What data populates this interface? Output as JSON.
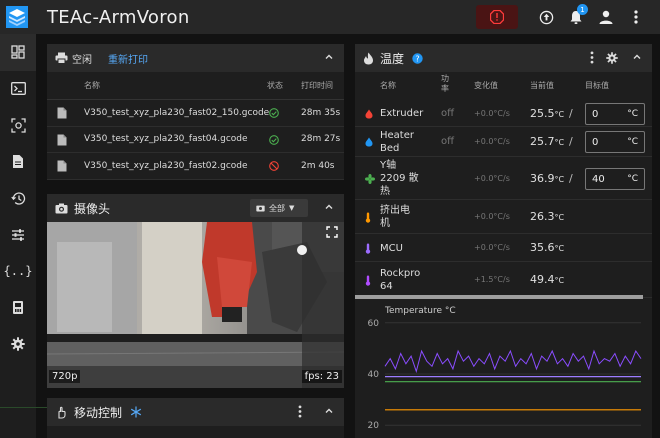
{
  "app": {
    "title": "TEAc-ArmVoron",
    "notification_count": "1"
  },
  "icons": {
    "logo": "stacked-layers-logo",
    "emergency": "emergency-stop-icon",
    "update": "arrow-up-circle-icon",
    "bell": "bell-icon",
    "user": "account-icon",
    "menu": "dots-vertical-icon"
  },
  "sidebar": {
    "items": [
      {
        "name": "dashboard"
      },
      {
        "name": "console"
      },
      {
        "name": "webcam"
      },
      {
        "name": "files"
      },
      {
        "name": "history"
      },
      {
        "name": "tune"
      },
      {
        "name": "macros"
      },
      {
        "name": "system"
      },
      {
        "name": "settings"
      }
    ]
  },
  "jobs": {
    "status_label": "空闲",
    "reprint_label": "重新打印",
    "headers": {
      "name": "名称",
      "status": "状态",
      "print_time": "打印时间"
    },
    "rows": [
      {
        "name": "V350_test_xyz_pla230_fast02_150.gcode",
        "status": "success",
        "time": "28m 35s"
      },
      {
        "name": "V350_test_xyz_pla230_fast04.gcode",
        "status": "success",
        "time": "28m 27s"
      },
      {
        "name": "V350_test_xyz_pla230_fast02.gcode",
        "status": "cancelled",
        "time": "2m 40s"
      }
    ]
  },
  "camera": {
    "title": "摄像头",
    "select_value": "全部",
    "resolution": "720p",
    "fps": "fps: 23"
  },
  "motion": {
    "title": "移动控制"
  },
  "temperature": {
    "title": "温度",
    "headers": {
      "name": "名称",
      "power": "功\n率",
      "rate": "变化值",
      "current": "当前值",
      "target": "目标值"
    },
    "rows": [
      {
        "name": "Extruder",
        "power": "off",
        "rate": "+0.0°C/s",
        "current": "25.5",
        "unit": "°C",
        "target": "0",
        "target_unit": "°C",
        "color": "#f44336"
      },
      {
        "name": "Heater\nBed",
        "power": "off",
        "rate": "+0.0°C/s",
        "current": "25.7",
        "unit": "°C",
        "target": "0",
        "target_unit": "°C",
        "color": "#2196f3"
      },
      {
        "name": "Y轴\n2209 散\n热",
        "power": "",
        "rate": "+0.0°C/s",
        "current": "36.9",
        "unit": "°C",
        "target": "40",
        "target_unit": "°C",
        "color": "#4caf50"
      },
      {
        "name": "挤出电\n机",
        "power": "",
        "rate": "+0.0°C/s",
        "current": "26.3",
        "unit": "°C",
        "color": "#ff9800"
      },
      {
        "name": "MCU",
        "power": "",
        "rate": "+0.0°C/s",
        "current": "35.6",
        "unit": "°C",
        "color": "#9c6cff"
      },
      {
        "name": "Rockpro\n64",
        "power": "",
        "rate": "+1.5°C/s",
        "current": "49.4",
        "unit": "°C",
        "color": "#b04cff"
      }
    ]
  },
  "chart_data": {
    "type": "line",
    "title": "Temperature °C",
    "yticks": [
      60,
      40,
      20
    ],
    "series": [
      {
        "values": [
          43,
          46,
          42,
          48,
          44,
          47,
          41,
          49,
          45,
          43,
          48,
          44,
          46,
          42,
          49,
          45,
          47,
          43,
          46,
          44,
          48,
          42,
          47,
          45,
          49,
          43,
          46,
          44,
          48,
          42,
          47,
          45,
          49,
          44,
          46,
          43,
          48,
          45,
          47,
          42,
          49,
          44,
          46,
          45,
          48,
          43,
          47,
          44,
          49,
          46
        ],
        "color": "#8a4dff"
      },
      {
        "values": [
          39,
          39,
          39,
          39,
          39,
          39,
          39,
          39,
          39,
          39,
          39,
          39,
          39,
          39,
          39,
          39,
          39,
          39,
          39,
          39,
          39,
          39,
          39,
          39,
          39,
          39,
          39,
          39,
          39,
          39,
          39,
          39,
          39,
          39,
          39,
          39,
          39,
          39,
          39,
          39,
          39,
          39,
          39,
          39,
          39,
          39,
          39,
          39,
          39,
          39
        ],
        "color": "#9c7cff"
      },
      {
        "values": [
          37,
          37,
          37,
          37,
          37,
          37,
          37,
          37,
          37,
          37,
          37,
          37,
          37,
          37,
          37,
          37,
          37,
          37,
          37,
          37,
          37,
          37,
          37,
          37,
          37,
          37,
          37,
          37,
          37,
          37,
          37,
          37,
          37,
          37,
          37,
          37,
          37,
          37,
          37,
          37,
          37,
          37,
          37,
          37,
          37,
          37,
          37,
          37,
          37,
          37
        ],
        "color": "#4caf50"
      },
      {
        "values": [
          26,
          26,
          26,
          26,
          26,
          26,
          26,
          26,
          26,
          26,
          26,
          26,
          26,
          26,
          26,
          26,
          26,
          26,
          26,
          26,
          26,
          26,
          26,
          26,
          26,
          26,
          26,
          26,
          26,
          26,
          26,
          26,
          26,
          26,
          26,
          26,
          26,
          26,
          26,
          26,
          26,
          26,
          26,
          26,
          26,
          26,
          26,
          26,
          26,
          26
        ],
        "color": "#ff9800"
      }
    ],
    "ylim": [
      15,
      65
    ]
  }
}
